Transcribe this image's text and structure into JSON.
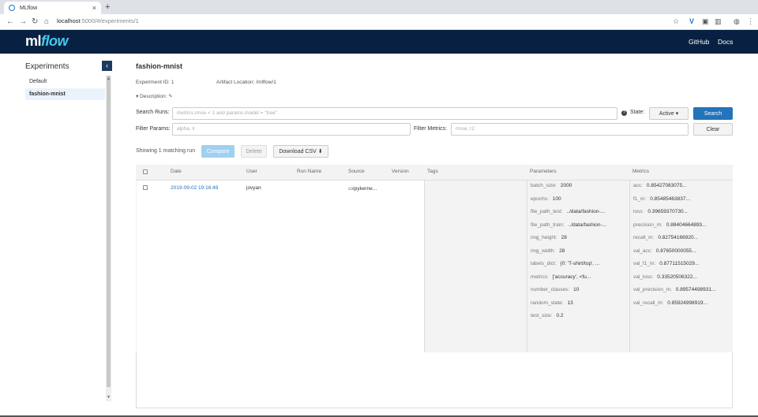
{
  "browser": {
    "tab_title": "MLflow",
    "url_host": "localhost",
    "url_rest": ":5000/#/experiments/1"
  },
  "header": {
    "logo_ml": "ml",
    "logo_flow": "flow",
    "links": [
      "GitHub",
      "Docs"
    ]
  },
  "sidebar": {
    "title": "Experiments",
    "items": [
      {
        "label": "Default",
        "active": false
      },
      {
        "label": "fashion-mnist",
        "active": true
      }
    ]
  },
  "experiment": {
    "name": "fashion-mnist",
    "id_label": "Experiment ID:",
    "id_value": "1",
    "artifact_label": "Artifact Location:",
    "artifact_value": "/mlflow/1",
    "description_label": "Description:"
  },
  "search": {
    "runs_label": "Search Runs:",
    "runs_placeholder": "metrics.rmse < 1 and params.model = \"tree\"",
    "state_label": "State:",
    "state_value": "Active",
    "search_button": "Search",
    "params_label": "Filter Params:",
    "params_placeholder": "alpha, lr",
    "metrics_label": "Filter Metrics:",
    "metrics_placeholder": "rmse, r2",
    "clear_button": "Clear"
  },
  "actions": {
    "matching": "Showing 1 matching run",
    "compare": "Compare",
    "delete": "Delete",
    "download": "Download CSV"
  },
  "table": {
    "headers": {
      "date": "Date",
      "user": "User",
      "run_name": "Run Name",
      "source": "Source",
      "version": "Version",
      "tags": "Tags",
      "parameters": "Parameters",
      "metrics": "Metrics"
    },
    "row": {
      "date": "2019-09-02 19:16:49",
      "user": "jovyan",
      "source": "ipykerne...",
      "params": [
        {
          "k": "batch_size:",
          "v": "2000"
        },
        {
          "k": "epochs:",
          "v": "100"
        },
        {
          "k": "file_path_test:",
          "v": "../data/fashion-..."
        },
        {
          "k": "file_path_train:",
          "v": "../data/fashion-..."
        },
        {
          "k": "img_height:",
          "v": "28"
        },
        {
          "k": "img_width:",
          "v": "28"
        },
        {
          "k": "labels_dict:",
          "v": "{0: 'T-shirt/top', ..."
        },
        {
          "k": "metrics:",
          "v": "['accuracy', <fu..."
        },
        {
          "k": "number_classes:",
          "v": "10"
        },
        {
          "k": "random_state:",
          "v": "13"
        },
        {
          "k": "test_size:",
          "v": "0.2"
        }
      ],
      "metrics": [
        {
          "k": "acc:",
          "v": "0.85427083075..."
        },
        {
          "k": "f1_m:",
          "v": "0.85485463837..."
        },
        {
          "k": "loss:",
          "v": "0.39659370730..."
        },
        {
          "k": "precision_m:",
          "v": "0.88404664893..."
        },
        {
          "k": "recall_m:",
          "v": "0.82754166920..."
        },
        {
          "k": "val_acc:",
          "v": "0.87650000055..."
        },
        {
          "k": "val_f1_m:",
          "v": "0.87711515029..."
        },
        {
          "k": "val_loss:",
          "v": "0.33520506322..."
        },
        {
          "k": "val_precision_m:",
          "v": "0.89574498931..."
        },
        {
          "k": "val_recall_m:",
          "v": "0.85924998919..."
        }
      ]
    }
  }
}
